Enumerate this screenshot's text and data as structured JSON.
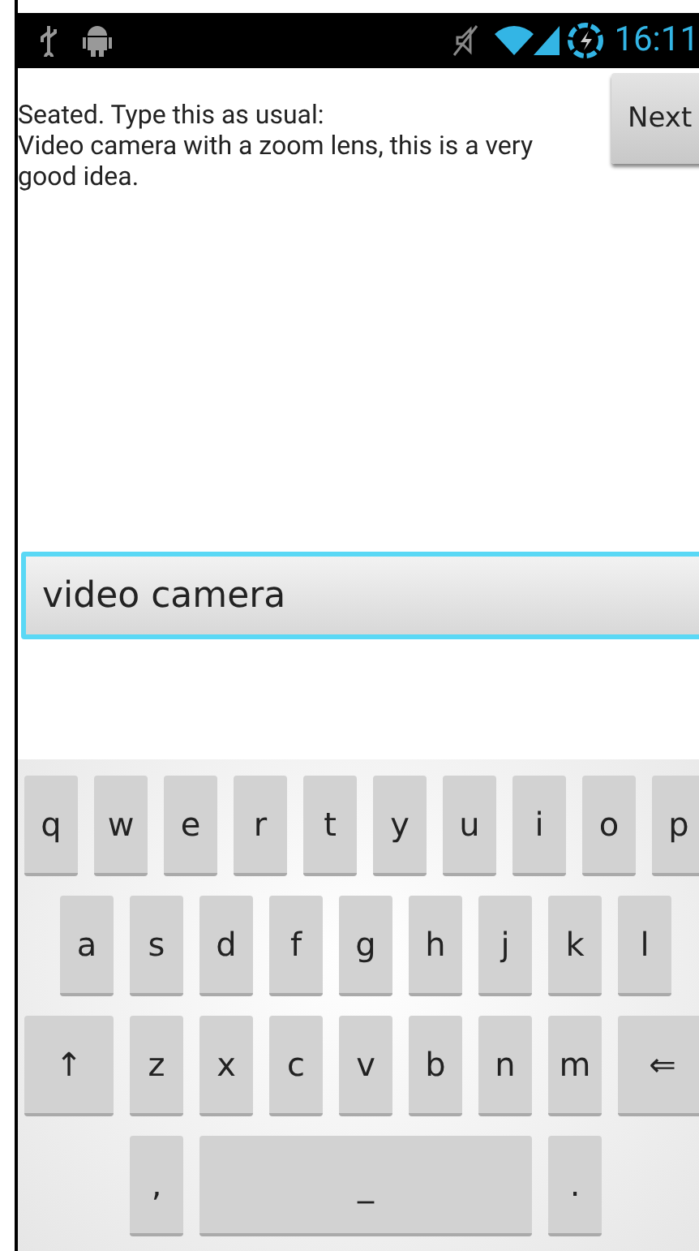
{
  "status_bar": {
    "time": "16:11"
  },
  "prompt": {
    "instruction": "Seated. Type this as usual:",
    "phrase": "Video camera with a zoom lens, this is a very good idea."
  },
  "next_button": {
    "label": "Next"
  },
  "input": {
    "value": "video camera",
    "focused": true
  },
  "keyboard": {
    "rows": [
      [
        {
          "label": "q",
          "kind": "char"
        },
        {
          "label": "w",
          "kind": "char"
        },
        {
          "label": "e",
          "kind": "char"
        },
        {
          "label": "r",
          "kind": "char"
        },
        {
          "label": "t",
          "kind": "char"
        },
        {
          "label": "y",
          "kind": "char"
        },
        {
          "label": "u",
          "kind": "char"
        },
        {
          "label": "i",
          "kind": "char"
        },
        {
          "label": "o",
          "kind": "char"
        },
        {
          "label": "p",
          "kind": "char"
        }
      ],
      [
        {
          "label": "a",
          "kind": "char"
        },
        {
          "label": "s",
          "kind": "char"
        },
        {
          "label": "d",
          "kind": "char"
        },
        {
          "label": "f",
          "kind": "char"
        },
        {
          "label": "g",
          "kind": "char"
        },
        {
          "label": "h",
          "kind": "char"
        },
        {
          "label": "j",
          "kind": "char"
        },
        {
          "label": "k",
          "kind": "char"
        },
        {
          "label": "l",
          "kind": "char"
        }
      ],
      [
        {
          "label": "↑",
          "kind": "shift"
        },
        {
          "label": "z",
          "kind": "char"
        },
        {
          "label": "x",
          "kind": "char"
        },
        {
          "label": "c",
          "kind": "char"
        },
        {
          "label": "v",
          "kind": "char"
        },
        {
          "label": "b",
          "kind": "char"
        },
        {
          "label": "n",
          "kind": "char"
        },
        {
          "label": "m",
          "kind": "char"
        },
        {
          "label": "⇐",
          "kind": "backspace"
        }
      ]
    ],
    "bottom_row": [
      {
        "label": ",",
        "kind": "char"
      },
      {
        "label": "_",
        "kind": "space"
      },
      {
        "label": ".",
        "kind": "char"
      }
    ]
  }
}
